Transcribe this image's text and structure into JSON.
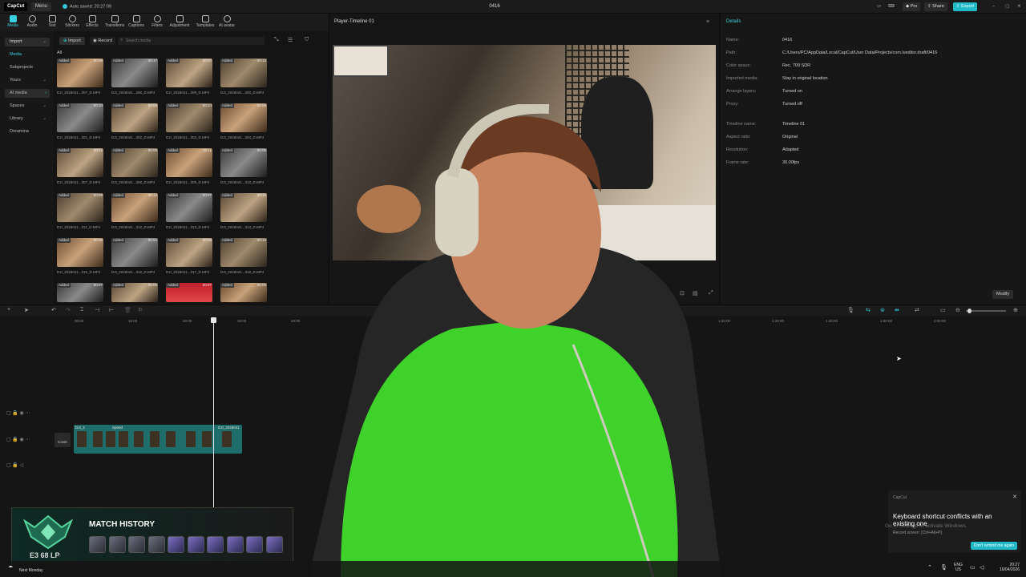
{
  "titlebar": {
    "logo": "CapCut",
    "menu": "Menu",
    "autosave": "Auto saved: 20:27:09",
    "title": "0416",
    "pro": "Pro",
    "share": "Share",
    "export": "Export"
  },
  "toolbar": {
    "tools": [
      "Media",
      "Audio",
      "Text",
      "Stickers",
      "Effects",
      "Transitions",
      "Captions",
      "Filters",
      "Adjustment",
      "Templates",
      "AI avatar"
    ]
  },
  "leftnav": {
    "items": [
      "Import",
      "Media",
      "Subprojects",
      "Yours",
      "AI media",
      "Spaces",
      "Library",
      "Dreamina"
    ]
  },
  "media": {
    "import": "Import",
    "record": "Record",
    "search_placeholder": "Search media",
    "filter_all": "All",
    "badge": "Added",
    "thumbs": [
      {
        "label": "DJI_2026041...297_D.MP4",
        "dur": "00:08"
      },
      {
        "label": "DJI_2026041...298_D.MP4",
        "dur": "00:17"
      },
      {
        "label": "DJI_2026041...299_D.MP4",
        "dur": "00:07"
      },
      {
        "label": "DJI_2026041...300_D.MP4",
        "dur": "00:12"
      },
      {
        "label": "DJI_2026041...301_D.MP4",
        "dur": "00:10"
      },
      {
        "label": "DJI_2026041...302_D.MP4",
        "dur": "00:06"
      },
      {
        "label": "DJI_2026041...303_D.MP4",
        "dur": "00:14"
      },
      {
        "label": "DJI_2026041...304_D.MP4",
        "dur": "00:09"
      },
      {
        "label": "DJI_2026041...307_D.MP4",
        "dur": "00:21"
      },
      {
        "label": "DJI_2026041...308_D.MP4",
        "dur": "00:08"
      },
      {
        "label": "DJI_2026041...309_D.MP4",
        "dur": "00:11"
      },
      {
        "label": "DJI_2026041...310_D.MP4",
        "dur": "00:05"
      },
      {
        "label": "DJI_2026041...311_D.MP4",
        "dur": "00:09"
      },
      {
        "label": "DJI_2026041...312_D.MP4",
        "dur": "00:13"
      },
      {
        "label": "DJI_2026041...313_D.MP4",
        "dur": "00:07"
      },
      {
        "label": "DJI_2026041...314_D.MP4",
        "dur": "00:10"
      },
      {
        "label": "DJI_2026041...315_D.MP4",
        "dur": "00:06"
      },
      {
        "label": "DJI_2026041...316_D.MP4",
        "dur": "00:54"
      },
      {
        "label": "DJI_2026041...317_D.MP4",
        "dur": "00:08"
      },
      {
        "label": "DJI_2026041...318_D.MP4",
        "dur": "00:12"
      },
      {
        "label": "",
        "dur": "00:07"
      },
      {
        "label": "",
        "dur": "00:05"
      },
      {
        "label": "",
        "dur": "00:07"
      },
      {
        "label": "",
        "dur": "00:05"
      }
    ]
  },
  "player": {
    "title": "Player-Timeline 01"
  },
  "details": {
    "tab": "Details",
    "rows": [
      {
        "k": "Name:",
        "v": "0416"
      },
      {
        "k": "Path:",
        "v": "C:/Users/PC/AppData/Local/CapCut/User Data/Projects/com.lveditor.draft/0416"
      },
      {
        "k": "Color space:",
        "v": "Rec. 709 SDR"
      },
      {
        "k": "Imported media:",
        "v": "Stay in original location"
      },
      {
        "k": "Arrange layers:",
        "v": "Turned on"
      },
      {
        "k": "Proxy:",
        "v": "Turned off"
      },
      {
        "k": "Timeline name:",
        "v": "Timeline 01"
      },
      {
        "k": "Aspect ratio:",
        "v": "Original"
      },
      {
        "k": "Resolution:",
        "v": "Adapted"
      },
      {
        "k": "Frame rate:",
        "v": "30.00fps"
      }
    ],
    "modify": "Modify"
  },
  "timeline": {
    "ruler": [
      "00:00",
      "10:00",
      "20:00",
      "30:00",
      "40:00",
      "1:00:00",
      "1:10:00",
      "1:20:00",
      "1:30:00",
      "1:40:00",
      "1:50:00",
      "2:00:00"
    ],
    "cover": "Cover",
    "clip_labels": [
      "DJI_2",
      "Speed",
      "DJI_2026041"
    ]
  },
  "toast": {
    "app": "CapCut",
    "message": "Keyboard shortcut conflicts with an existing one",
    "sub": "Record screen: [Ctrl+Alt+P]",
    "button": "Don't remind me again",
    "activate": "Go to Settings to activate Windows."
  },
  "overlay": {
    "title": "MATCH HISTORY",
    "rank": "E3 68 LP"
  },
  "taskbar": {
    "lang": "ENG",
    "region": "US",
    "time": "20:27",
    "date": "16/04/2026",
    "notif": "Next Monday"
  }
}
